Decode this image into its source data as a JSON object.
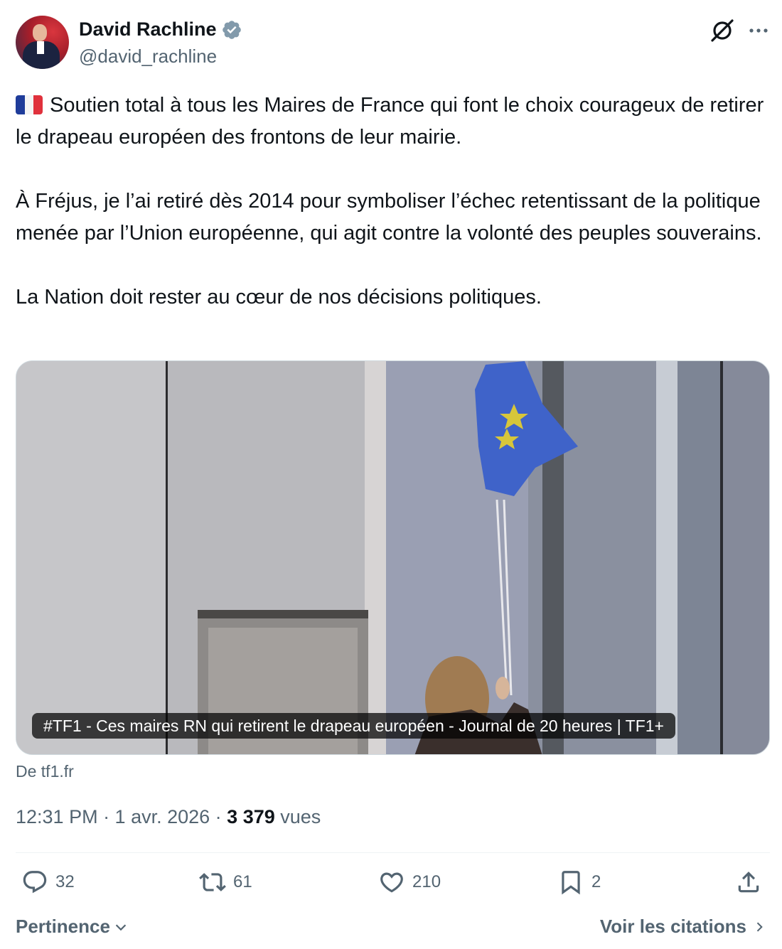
{
  "author": {
    "name": "David Rachline",
    "handle": "@david_rachline",
    "verified": true
  },
  "tweet": {
    "paragraph1": "Soutien total à tous les Maires de France qui font le choix courageux de retirer le drapeau européen des frontons de leur mairie.",
    "paragraph2": "À Fréjus, je l’ai retiré dès 2014 pour symboliser l’échec retentissant de la politique menée par l’Union européenne, qui agit contre la volonté des peuples souverains.",
    "paragraph3": "La Nation doit rester au cœur de nos décisions politiques.",
    "flag_emoji": "french-flag-emoji"
  },
  "media": {
    "caption": "#TF1 - Ces maires RN qui retirent le drapeau européen - Journal de 20 heures | TF1+",
    "source": "De tf1.fr"
  },
  "meta": {
    "time_date": "12:31 PM · 1 avr. 2026 · ",
    "views_count": "3 379",
    "views_label": " vues"
  },
  "actions": {
    "replies": "32",
    "reposts": "61",
    "likes": "210",
    "bookmarks": "2"
  },
  "footer": {
    "sort_label": "Pertinence",
    "quotes_label": "Voir les citations"
  },
  "colors": {
    "text_primary": "#0f1419",
    "text_secondary": "#536471",
    "verified": "#829aab",
    "divider": "#eff3f4",
    "border": "#cfd9de",
    "eu_blue": "#3f63c9"
  },
  "icons": [
    "grok-icon",
    "more-icon",
    "verified-badge-icon",
    "reply-icon",
    "repost-icon",
    "like-icon",
    "bookmark-icon",
    "share-icon",
    "chevron-down-icon",
    "chevron-right-icon"
  ]
}
